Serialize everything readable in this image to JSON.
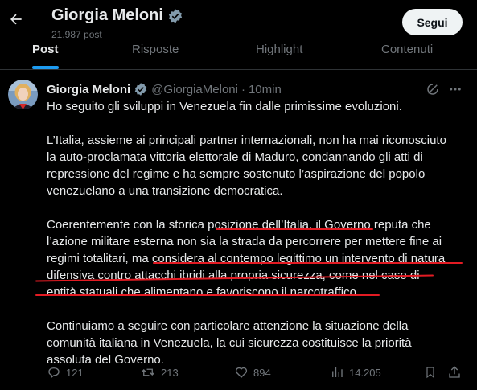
{
  "header": {
    "name": "Giorgia Meloni",
    "post_count": "21.987 post",
    "follow_label": "Segui"
  },
  "tabs": [
    {
      "label": "Post",
      "active": true
    },
    {
      "label": "Risposte",
      "active": false
    },
    {
      "label": "Highlight",
      "active": false
    },
    {
      "label": "Contenuti",
      "active": false
    }
  ],
  "post": {
    "author": "Giorgia Meloni",
    "handle": "@GiorgiaMeloni",
    "separator": "·",
    "time": "10min",
    "paragraphs": [
      [
        "Ho seguito gli sviluppi in Venezuela fin dalle primissime evoluzioni."
      ],
      [
        "L’Italia, assieme ai principali partner internazionali, non ha mai riconosciuto",
        "la auto-proclamata vittoria elettorale di Maduro, condannando gli atti di",
        "repressione del regime e ha sempre sostenuto l’aspirazione del popolo",
        "venezuelano a una transizione democratica."
      ],
      [
        "Coerentemente con la storica posizione dell’Italia, il Governo reputa che",
        "l’azione militare esterna non sia la strada da percorrere per mettere fine ai",
        "regimi totalitari, ma considera al contempo legittimo un intervento di natura",
        "difensiva contro attacchi ibridi alla propria sicurezza, come nel caso di",
        "entità statuali che alimentano e favoriscono il narcotraffico."
      ],
      [
        "Continuiamo a seguire con particolare attenzione la situazione della",
        "comunità italiana in Venezuela, la cui sicurezza costituisce la priorità",
        "assoluta del Governo."
      ]
    ],
    "actions": {
      "replies": "121",
      "reposts": "213",
      "likes": "894",
      "views": "14.205"
    }
  },
  "colors": {
    "background": "#000000",
    "text": "#e7e9ea",
    "muted": "#71767b",
    "accent": "#1d9bf0",
    "verified": "#829aab",
    "annotation": "#e31b23"
  },
  "icons": [
    "back-arrow-icon",
    "verified-badge-icon",
    "grok-icon",
    "more-icon",
    "reply-icon",
    "repost-icon",
    "like-icon",
    "views-icon",
    "bookmark-icon",
    "share-icon"
  ]
}
